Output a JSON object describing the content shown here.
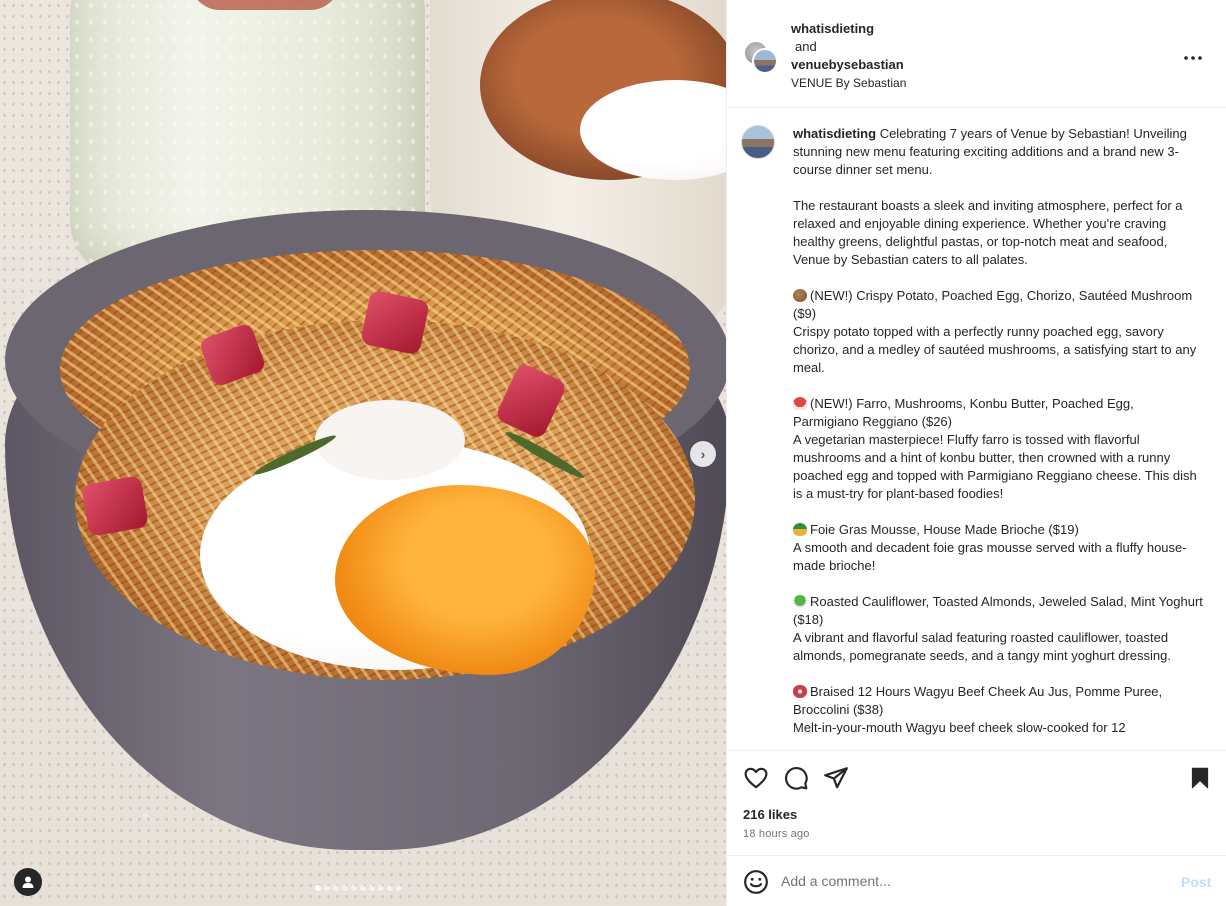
{
  "header": {
    "user1": "whatisdieting",
    "and": "and",
    "user2": "venuebysebastian",
    "location": "VENUE By Sebastian",
    "more_icon": "more-horizontal-icon"
  },
  "caption": {
    "username": "whatisdieting",
    "intro": "Celebrating 7 years of Venue by Sebastian! Unveiling stunning new menu featuring exciting additions and a brand new 3-course dinner set menu.",
    "para2": "The restaurant boasts a sleek and inviting atmosphere, perfect for a relaxed and enjoyable dining experience. Whether you're craving healthy greens, delightful pastas, or top-notch meat and seafood, Venue by Sebastian caters to all palates.",
    "items": [
      {
        "icon": "potato-emoji",
        "title": "(NEW!) Crispy Potato, Poached Egg, Chorizo, Sautéed Mushroom ($9)",
        "desc": "Crispy potato topped with a perfectly runny poached egg, savory chorizo, and a medley of sautéed mushrooms, a satisfying start to any meal."
      },
      {
        "icon": "mushroom-emoji",
        "title": "(NEW!) Farro, Mushrooms, Konbu Butter, Poached Egg, Parmigiano Reggiano ($26)",
        "desc": "A vegetarian masterpiece! Fluffy farro is tossed with flavorful mushrooms and a hint of konbu butter, then crowned with a runny poached egg and topped with Parmigiano Reggiano cheese. This dish is a must-try for plant-based foodies!"
      },
      {
        "icon": "duck-emoji",
        "title": "Foie Gras Mousse, House Made Brioche ($19)",
        "desc": "A smooth and decadent foie gras mousse served with a fluffy house-made brioche!"
      },
      {
        "icon": "salad-emoji",
        "title": "Roasted Cauliflower, Toasted Almonds, Jeweled Salad, Mint Yoghurt ($18)",
        "desc": "A vibrant and flavorful salad featuring roasted cauliflower, toasted almonds, pomegranate seeds, and a tangy mint yoghurt dressing."
      },
      {
        "icon": "steak-emoji",
        "title": "Braised 12 Hours Wagyu Beef Cheek Au Jus, Pomme Puree, Broccolini ($38)",
        "desc": "Melt-in-your-mouth Wagyu beef cheek slow-cooked for 12"
      }
    ]
  },
  "actions": {
    "likes": "216 likes",
    "time": "18 hours ago"
  },
  "comment": {
    "placeholder": "Add a comment...",
    "post_label": "Post"
  },
  "carousel": {
    "total_slides": 10,
    "active_slide": 1
  }
}
